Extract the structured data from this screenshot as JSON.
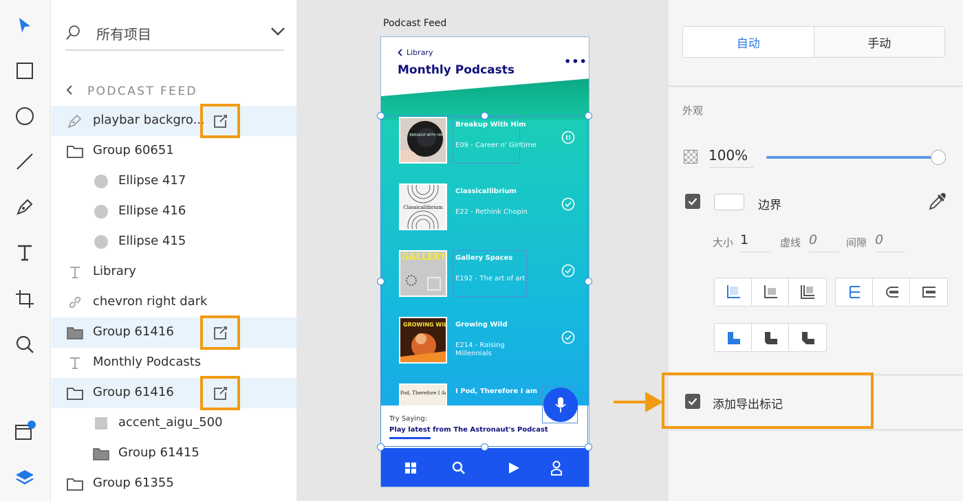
{
  "layers_panel": {
    "search": {
      "placeholder": "所有项目"
    },
    "breadcrumb": "PODCAST FEED",
    "items": [
      {
        "label": "playbar backgro...",
        "icon": "pen-path-icon",
        "selected": true,
        "export": true,
        "indent": 0
      },
      {
        "label": "Group 60651",
        "icon": "folder-icon",
        "selected": false,
        "export": false,
        "indent": 0
      },
      {
        "label": "Ellipse 417",
        "icon": "ellipse-icon",
        "selected": false,
        "export": false,
        "indent": 1
      },
      {
        "label": "Ellipse 416",
        "icon": "ellipse-icon",
        "selected": false,
        "export": false,
        "indent": 1
      },
      {
        "label": "Ellipse 415",
        "icon": "ellipse-icon",
        "selected": false,
        "export": false,
        "indent": 1
      },
      {
        "label": "Library",
        "icon": "text-icon",
        "selected": false,
        "export": false,
        "indent": 0
      },
      {
        "label": "chevron right dark",
        "icon": "link-icon",
        "selected": false,
        "export": false,
        "indent": 0
      },
      {
        "label": "Group 61416",
        "icon": "folder-filled-icon",
        "selected": true,
        "export": true,
        "indent": 0
      },
      {
        "label": "Monthly Podcasts",
        "icon": "text-icon",
        "selected": false,
        "export": false,
        "indent": 0
      },
      {
        "label": "Group 61416",
        "icon": "folder-icon",
        "selected": true,
        "export": true,
        "indent": 0
      },
      {
        "label": "accent_aigu_500",
        "icon": "rectangle-icon",
        "selected": false,
        "export": false,
        "indent": 1
      },
      {
        "label": "Group 61415",
        "icon": "folder-filled-icon",
        "selected": false,
        "export": false,
        "indent": 1
      },
      {
        "label": "Group 61355",
        "icon": "folder-icon",
        "selected": false,
        "export": false,
        "indent": 0
      }
    ]
  },
  "canvas": {
    "artboard_label": "Podcast Feed",
    "app": {
      "back_label": "Library",
      "title": "Monthly Podcasts",
      "more": "•••",
      "podcasts": [
        {
          "title": "Breakup With Him",
          "subtitle": "E09 - Career n' Girltime",
          "status": "pause"
        },
        {
          "title": "Classicallibrium",
          "subtitle": "E22 - Rethink Chopin",
          "status": "check"
        },
        {
          "title": "Gallery Spaces",
          "subtitle": "E192 - The art of art",
          "status": "check"
        },
        {
          "title": "Growing Wild",
          "subtitle": "E214 - Raising Millennials",
          "status": "check"
        },
        {
          "title": "I Pod, Therefore I am",
          "subtitle": "",
          "status": "none"
        }
      ],
      "thumb_text": {
        "breakup": "BREAKUP WITH HIM",
        "classic": "Classicallibrium",
        "gallery": "GALLERY SPACES",
        "growing": "GROWING WILD",
        "ipod": "I Pod, Therefore I Am"
      },
      "try_saying": "Try Saying:",
      "try_command": "Play latest from The Astronaut's Podcast"
    }
  },
  "properties": {
    "segment": {
      "auto": "自动",
      "manual": "手动"
    },
    "appearance_heading": "外观",
    "opacity": "100%",
    "opacity_fraction": 1.0,
    "border_label": "边界",
    "border_checked": true,
    "size_label": "大小",
    "size_value": "1",
    "dash_label": "虚线",
    "dash_value": "0",
    "gap_label": "间隙",
    "gap_value": "0",
    "export_label": "添加导出标记",
    "export_checked": true
  },
  "colors": {
    "accent_blue": "#2b7be4",
    "callout_orange": "#f29b12",
    "app_navy": "#11117a",
    "tabbar_blue": "#1a55f0"
  }
}
